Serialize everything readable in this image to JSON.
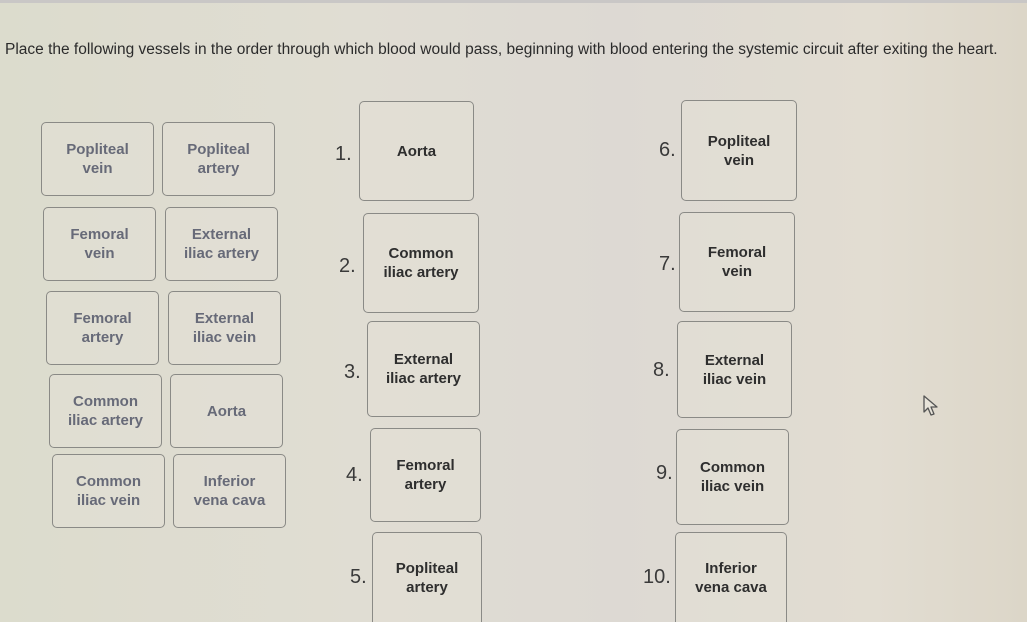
{
  "question": "Place the following vessels in the order through which blood would pass, beginning with blood entering the systemic circuit after exiting the heart.",
  "bank": [
    {
      "label": "Popliteal\nvein"
    },
    {
      "label": "Popliteal\nartery"
    },
    {
      "label": "Femoral\nvein"
    },
    {
      "label": "External\niliac artery"
    },
    {
      "label": "Femoral\nartery"
    },
    {
      "label": "External\niliac vein"
    },
    {
      "label": "Common\niliac artery"
    },
    {
      "label": "Aorta"
    },
    {
      "label": "Common\niliac vein"
    },
    {
      "label": "Inferior\nvena cava"
    }
  ],
  "slots": [
    {
      "number": "1.",
      "answer": "Aorta"
    },
    {
      "number": "2.",
      "answer": "Common\niliac artery"
    },
    {
      "number": "3.",
      "answer": "External\niliac artery"
    },
    {
      "number": "4.",
      "answer": "Femoral\nartery"
    },
    {
      "number": "5.",
      "answer": "Popliteal\nartery"
    },
    {
      "number": "6.",
      "answer": "Popliteal\nvein"
    },
    {
      "number": "7.",
      "answer": "Femoral\nvein"
    },
    {
      "number": "8.",
      "answer": "External\niliac vein"
    },
    {
      "number": "9.",
      "answer": "Common\niliac vein"
    },
    {
      "number": "10.",
      "answer": "Inferior\nvena cava"
    }
  ],
  "icons": {
    "cursor": "mouse-pointer-icon"
  }
}
